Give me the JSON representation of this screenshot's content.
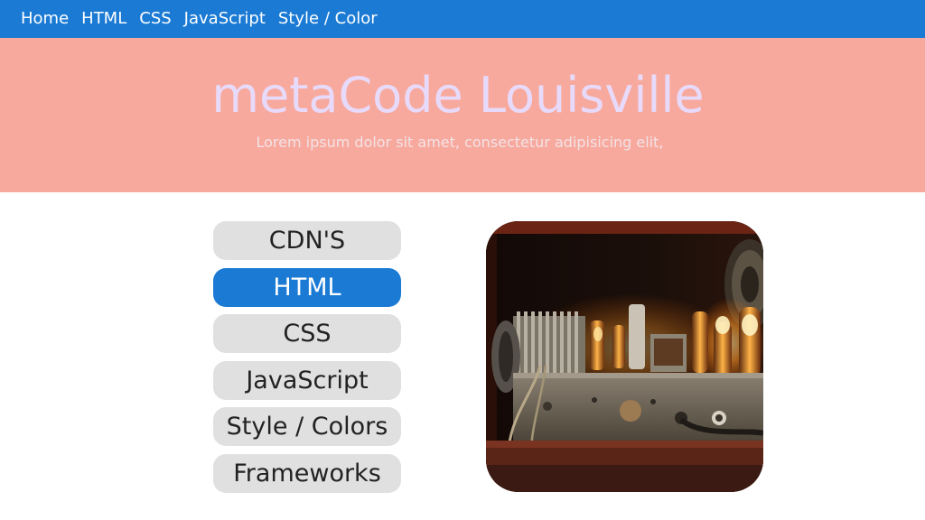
{
  "topnav": {
    "items": [
      {
        "label": "Home"
      },
      {
        "label": "HTML"
      },
      {
        "label": "CSS"
      },
      {
        "label": "JavaScript"
      },
      {
        "label": "Style / Color"
      }
    ]
  },
  "hero": {
    "title": "metaCode Louisville",
    "subtitle": "Lorem ipsum dolor sit amet, consectetur adipisicing elit,"
  },
  "menu": {
    "items": [
      {
        "label": "CDN'S",
        "active": false
      },
      {
        "label": "HTML",
        "active": true
      },
      {
        "label": "CSS",
        "active": false
      },
      {
        "label": "JavaScript",
        "active": false
      },
      {
        "label": "Style / Colors",
        "active": false
      },
      {
        "label": "Frameworks",
        "active": false
      }
    ]
  },
  "colors": {
    "nav_bg": "#1a7ad4",
    "hero_bg": "#f8a99d",
    "hero_title": "#e7dafa",
    "button_bg": "#e0e0e0",
    "button_active_bg": "#1a7ad4"
  }
}
